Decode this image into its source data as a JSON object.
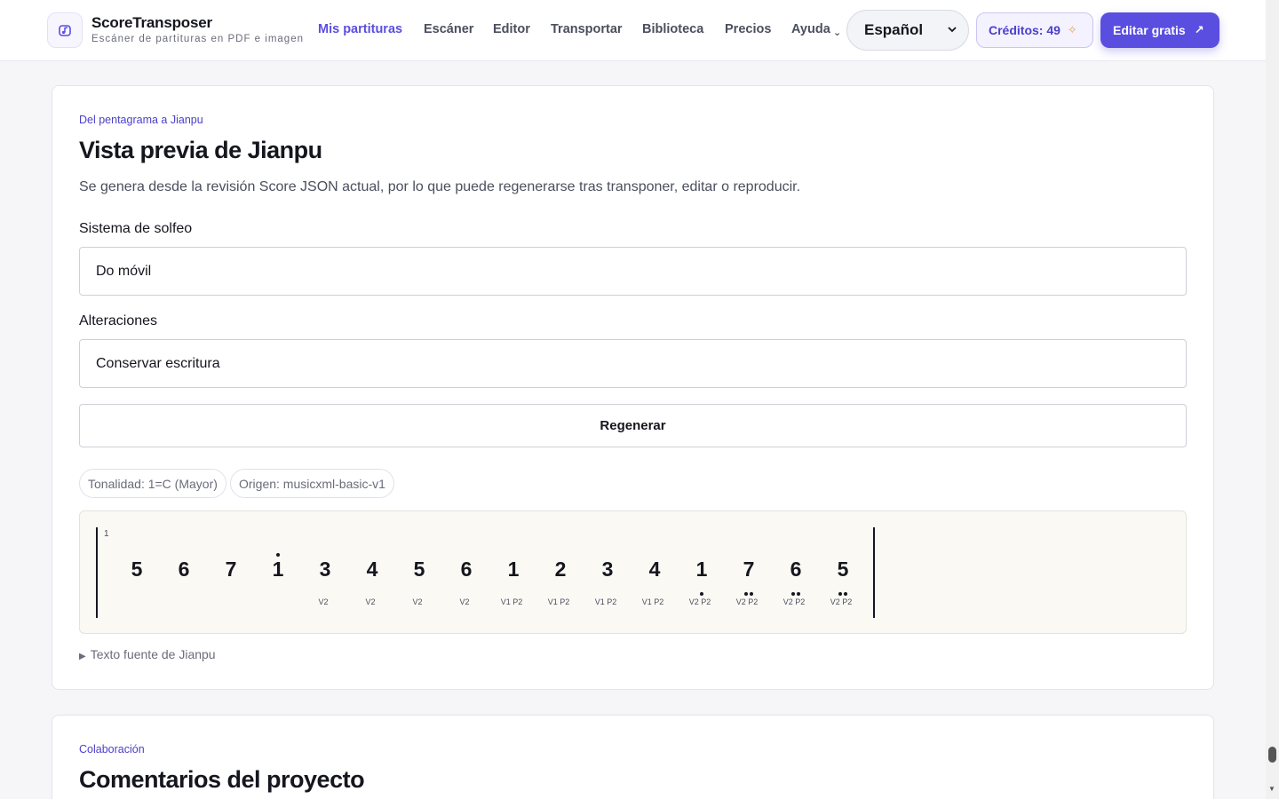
{
  "brand": {
    "name": "ScoreTransposer",
    "tagline": "Escáner de partituras en PDF e imagen",
    "icon": "music-note-icon"
  },
  "nav": {
    "items": [
      {
        "label": "Mis partituras",
        "active": true
      },
      {
        "label": "Escáner"
      },
      {
        "label": "Editor"
      },
      {
        "label": "Transportar"
      },
      {
        "label": "Biblioteca"
      },
      {
        "label": "Precios"
      },
      {
        "label": "Ayuda"
      }
    ],
    "help_caret": "⌄"
  },
  "language": {
    "selected": "Español"
  },
  "credits": {
    "label": "Créditos: 49"
  },
  "cta": {
    "label": "Editar gratis"
  },
  "jianpu_card": {
    "eyebrow": "Del pentagrama a Jianpu",
    "title": "Vista previa de Jianpu",
    "description": "Se genera desde la revisión Score JSON actual, por lo que puede regenerarse tras transponer, editar o reproducir.",
    "solfege_label": "Sistema de solfeo",
    "solfege_value": "Do móvil",
    "accidentals_label": "Alteraciones",
    "accidentals_value": "Conservar escritura",
    "regenerate_label": "Regenerar",
    "chips": [
      "Tonalidad: 1=C (Mayor)",
      "Origen: musicxml-basic-v1"
    ],
    "measure_number": "1",
    "notes": [
      {
        "digit": "5",
        "label": "",
        "dots_above": 0,
        "dots_below": 0
      },
      {
        "digit": "6",
        "label": "",
        "dots_above": 0,
        "dots_below": 0
      },
      {
        "digit": "7",
        "label": "",
        "dots_above": 0,
        "dots_below": 0
      },
      {
        "digit": "1",
        "label": "",
        "dots_above": 1,
        "dots_below": 0
      },
      {
        "digit": "3",
        "label": "V2",
        "dots_above": 0,
        "dots_below": 0
      },
      {
        "digit": "4",
        "label": "V2",
        "dots_above": 0,
        "dots_below": 0
      },
      {
        "digit": "5",
        "label": "V2",
        "dots_above": 0,
        "dots_below": 0
      },
      {
        "digit": "6",
        "label": "V2",
        "dots_above": 0,
        "dots_below": 0
      },
      {
        "digit": "1",
        "label": "V1 P2",
        "dots_above": 0,
        "dots_below": 0
      },
      {
        "digit": "2",
        "label": "V1 P2",
        "dots_above": 0,
        "dots_below": 0
      },
      {
        "digit": "3",
        "label": "V1 P2",
        "dots_above": 0,
        "dots_below": 0
      },
      {
        "digit": "4",
        "label": "V1 P2",
        "dots_above": 0,
        "dots_below": 0
      },
      {
        "digit": "1",
        "label": "V2 P2",
        "dots_above": 0,
        "dots_below": 1
      },
      {
        "digit": "7",
        "label": "V2 P2",
        "dots_above": 0,
        "dots_below": 2
      },
      {
        "digit": "6",
        "label": "V2 P2",
        "dots_above": 0,
        "dots_below": 2
      },
      {
        "digit": "5",
        "label": "V2 P2",
        "dots_above": 0,
        "dots_below": 2
      }
    ],
    "source_toggle": "Texto fuente de Jianpu"
  },
  "comments_card": {
    "eyebrow": "Colaboración",
    "title": "Comentarios del proyecto"
  },
  "colors": {
    "accent": "#5a4ee0",
    "credits_bg": "#f4f2ff",
    "jianpu_bg": "#faf9f4"
  }
}
